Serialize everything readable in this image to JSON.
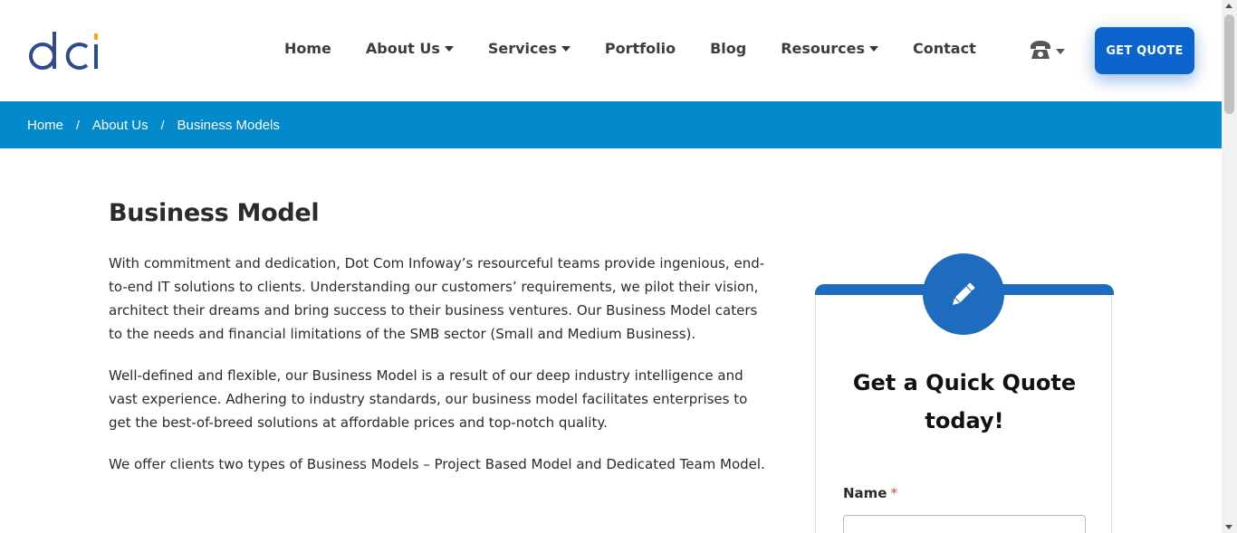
{
  "brand": {
    "logo_text": "dci",
    "primary_color": "#0b63ce",
    "accent_color": "#0489cc",
    "logo_dot_color": "#f5a623"
  },
  "nav": {
    "items": [
      {
        "label": "Home",
        "has_dropdown": false
      },
      {
        "label": "About Us",
        "has_dropdown": true
      },
      {
        "label": "Services",
        "has_dropdown": true
      },
      {
        "label": "Portfolio",
        "has_dropdown": false
      },
      {
        "label": "Blog",
        "has_dropdown": false
      },
      {
        "label": "Resources",
        "has_dropdown": true
      },
      {
        "label": "Contact",
        "has_dropdown": false
      }
    ],
    "phone_icon": "phone-icon",
    "cta_label": "GET QUOTE"
  },
  "breadcrumb": {
    "items": [
      "Home",
      "About Us",
      "Business Models"
    ],
    "separator": "/"
  },
  "main": {
    "title": "Business Model",
    "paragraphs": [
      "With commitment and dedication, Dot Com Infoway’s resourceful teams provide ingenious, end-to-end IT solutions to clients. Understanding our customers’ requirements, we pilot their vision, architect their dreams and bring success to their business ventures. Our Business Model caters to the needs and financial limitations of the SMB sector (Small and Medium Business).",
      "Well-defined and flexible, our Business Model is a result of our deep industry intelligence and vast experience. Adhering to industry standards, our business model facilitates enterprises to get the best-of-breed solutions at affordable prices and top-notch quality.",
      "We offer clients two types of Business Models – Project Based Model and Dedicated Team Model."
    ]
  },
  "quote_form": {
    "icon": "pencil-icon",
    "title": "Get a Quick Quote today!",
    "name_label": "Name",
    "required_mark": "*"
  }
}
